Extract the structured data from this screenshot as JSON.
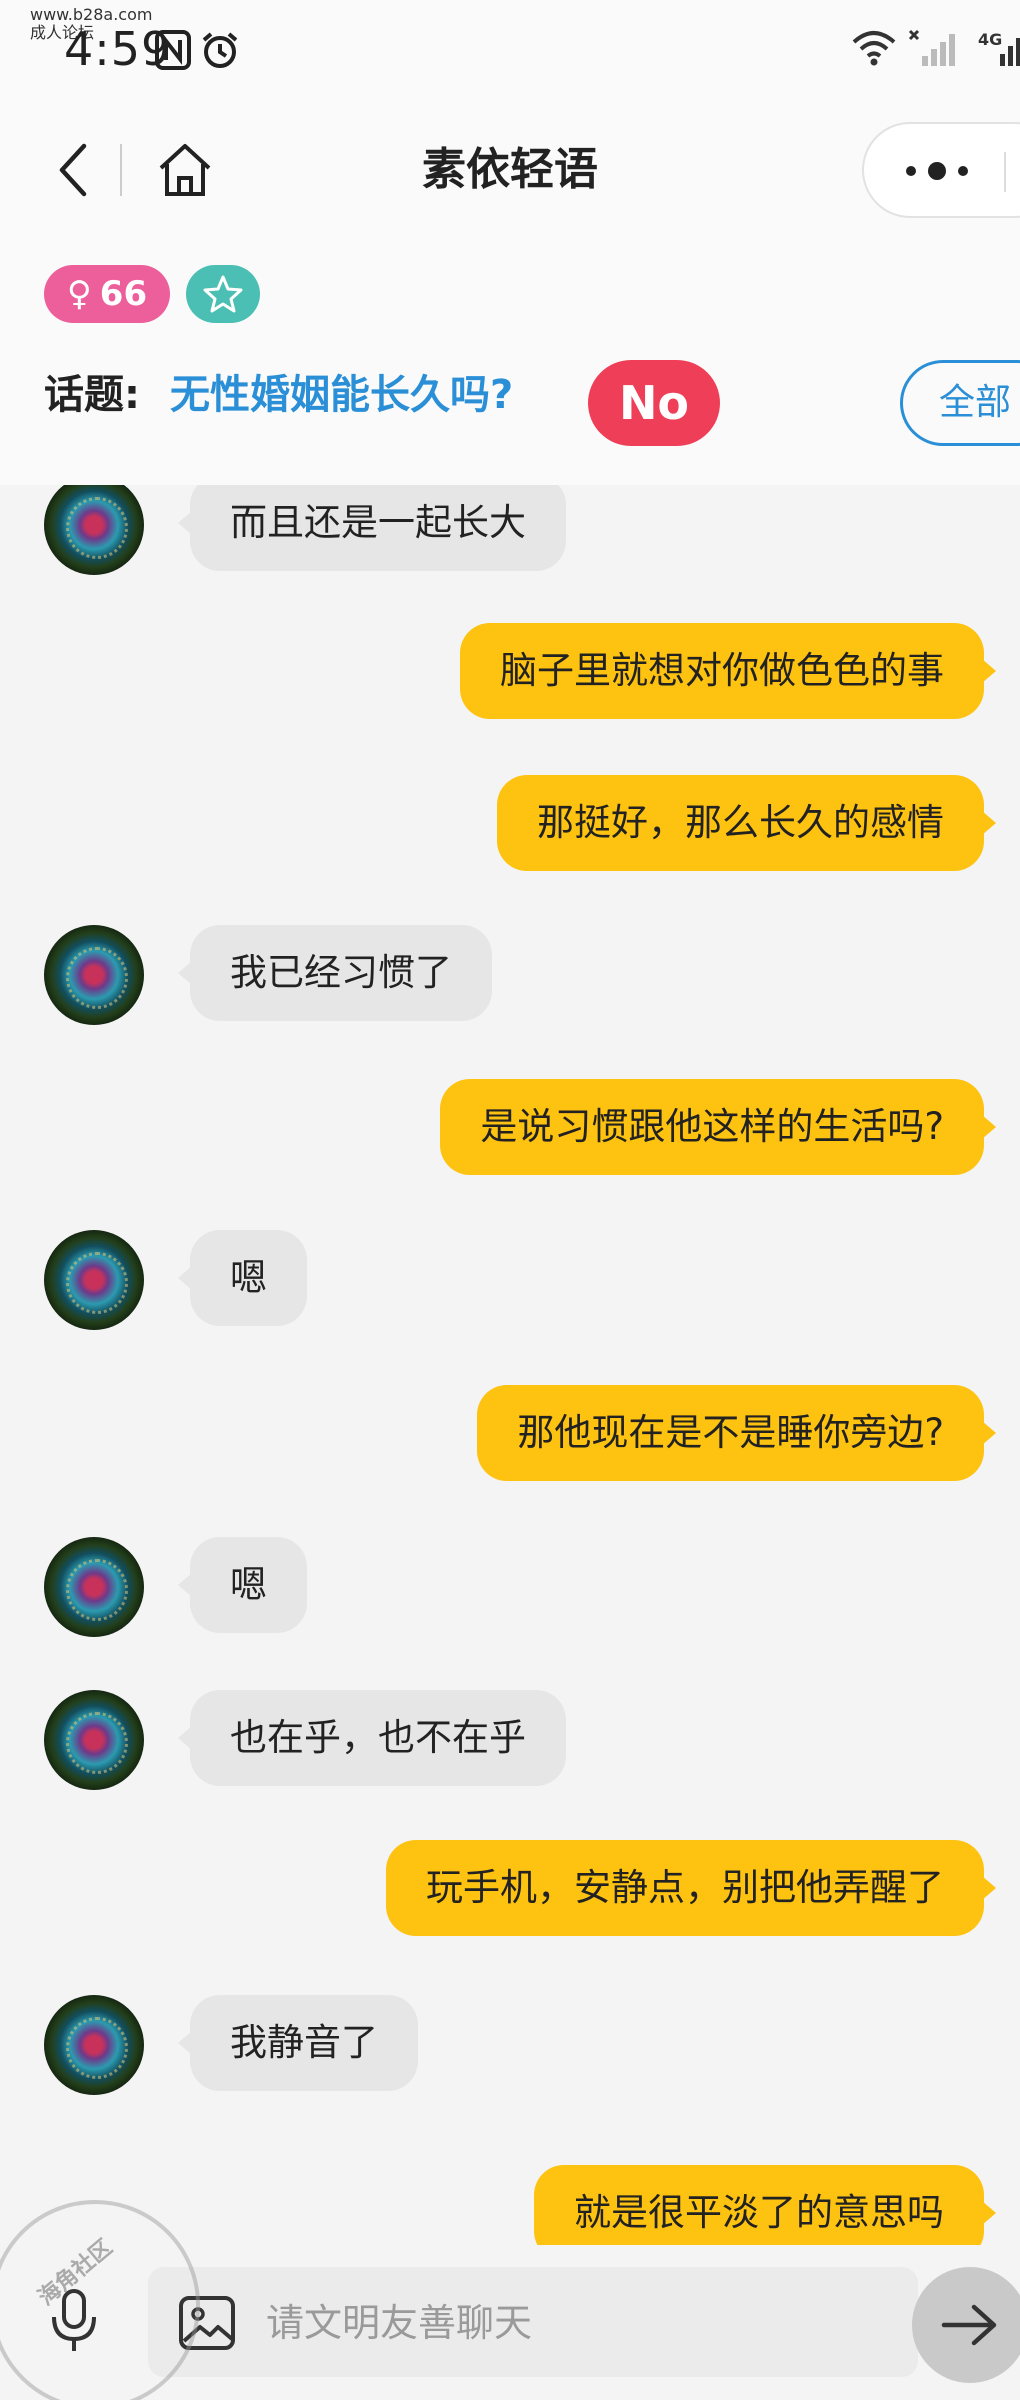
{
  "status_bar": {
    "site_watermark": "www.b28a.com",
    "site_watermark2": "成人论坛",
    "time": "4:59",
    "network": "4G"
  },
  "nav": {
    "title": "素依轻语"
  },
  "profile": {
    "gender_symbol": "♀",
    "age": "66",
    "accent_pink": "#ec5f9b",
    "accent_teal": "#4bbfb4"
  },
  "topic": {
    "label": "话题:",
    "text": "无性婚姻能长久吗?",
    "no_label": "No",
    "all_label": "全部"
  },
  "messages": [
    {
      "side": "left",
      "text": "而且还是一起长大"
    },
    {
      "side": "right",
      "text": "脑子里就想对你做色色的事"
    },
    {
      "side": "right",
      "text": "那挺好，那么长久的感情"
    },
    {
      "side": "left",
      "text": "我已经习惯了"
    },
    {
      "side": "right",
      "text": "是说习惯跟他这样的生活吗?"
    },
    {
      "side": "left",
      "text": "嗯"
    },
    {
      "side": "right",
      "text": "那他现在是不是睡你旁边?"
    },
    {
      "side": "left",
      "text": "嗯"
    },
    {
      "side": "left",
      "text": "也在乎，也不在乎"
    },
    {
      "side": "right",
      "text": "玩手机，安静点，别把他弄醒了"
    },
    {
      "side": "left",
      "text": "我静音了"
    },
    {
      "side": "right",
      "text": "就是很平淡了的意思吗"
    }
  ],
  "input": {
    "placeholder": "请文明友善聊天"
  },
  "watermark": {
    "text": "海角社区"
  },
  "colors": {
    "my_bubble": "#fec210",
    "their_bubble": "#e6e6e6",
    "no_button": "#ef3f58",
    "topic_link": "#2a8fd6"
  }
}
